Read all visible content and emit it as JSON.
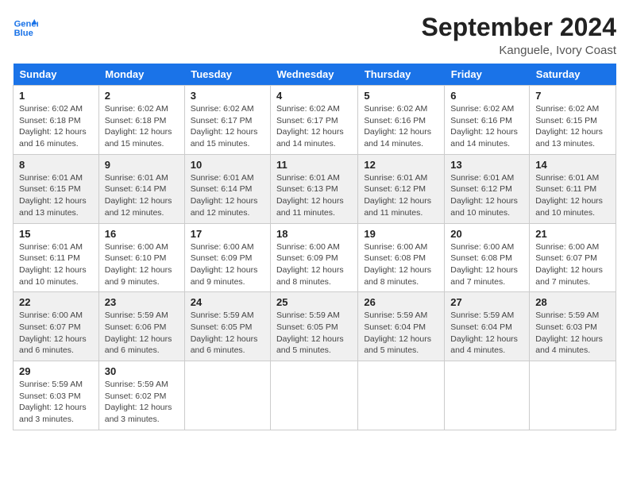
{
  "header": {
    "logo_line1": "General",
    "logo_line2": "Blue",
    "month": "September 2024",
    "location": "Kanguele, Ivory Coast"
  },
  "days_of_week": [
    "Sunday",
    "Monday",
    "Tuesday",
    "Wednesday",
    "Thursday",
    "Friday",
    "Saturday"
  ],
  "weeks": [
    [
      {
        "day": "1",
        "info": "Sunrise: 6:02 AM\nSunset: 6:18 PM\nDaylight: 12 hours\nand 16 minutes."
      },
      {
        "day": "2",
        "info": "Sunrise: 6:02 AM\nSunset: 6:18 PM\nDaylight: 12 hours\nand 15 minutes."
      },
      {
        "day": "3",
        "info": "Sunrise: 6:02 AM\nSunset: 6:17 PM\nDaylight: 12 hours\nand 15 minutes."
      },
      {
        "day": "4",
        "info": "Sunrise: 6:02 AM\nSunset: 6:17 PM\nDaylight: 12 hours\nand 14 minutes."
      },
      {
        "day": "5",
        "info": "Sunrise: 6:02 AM\nSunset: 6:16 PM\nDaylight: 12 hours\nand 14 minutes."
      },
      {
        "day": "6",
        "info": "Sunrise: 6:02 AM\nSunset: 6:16 PM\nDaylight: 12 hours\nand 14 minutes."
      },
      {
        "day": "7",
        "info": "Sunrise: 6:02 AM\nSunset: 6:15 PM\nDaylight: 12 hours\nand 13 minutes."
      }
    ],
    [
      {
        "day": "8",
        "info": "Sunrise: 6:01 AM\nSunset: 6:15 PM\nDaylight: 12 hours\nand 13 minutes."
      },
      {
        "day": "9",
        "info": "Sunrise: 6:01 AM\nSunset: 6:14 PM\nDaylight: 12 hours\nand 12 minutes."
      },
      {
        "day": "10",
        "info": "Sunrise: 6:01 AM\nSunset: 6:14 PM\nDaylight: 12 hours\nand 12 minutes."
      },
      {
        "day": "11",
        "info": "Sunrise: 6:01 AM\nSunset: 6:13 PM\nDaylight: 12 hours\nand 11 minutes."
      },
      {
        "day": "12",
        "info": "Sunrise: 6:01 AM\nSunset: 6:12 PM\nDaylight: 12 hours\nand 11 minutes."
      },
      {
        "day": "13",
        "info": "Sunrise: 6:01 AM\nSunset: 6:12 PM\nDaylight: 12 hours\nand 10 minutes."
      },
      {
        "day": "14",
        "info": "Sunrise: 6:01 AM\nSunset: 6:11 PM\nDaylight: 12 hours\nand 10 minutes."
      }
    ],
    [
      {
        "day": "15",
        "info": "Sunrise: 6:01 AM\nSunset: 6:11 PM\nDaylight: 12 hours\nand 10 minutes."
      },
      {
        "day": "16",
        "info": "Sunrise: 6:00 AM\nSunset: 6:10 PM\nDaylight: 12 hours\nand 9 minutes."
      },
      {
        "day": "17",
        "info": "Sunrise: 6:00 AM\nSunset: 6:09 PM\nDaylight: 12 hours\nand 9 minutes."
      },
      {
        "day": "18",
        "info": "Sunrise: 6:00 AM\nSunset: 6:09 PM\nDaylight: 12 hours\nand 8 minutes."
      },
      {
        "day": "19",
        "info": "Sunrise: 6:00 AM\nSunset: 6:08 PM\nDaylight: 12 hours\nand 8 minutes."
      },
      {
        "day": "20",
        "info": "Sunrise: 6:00 AM\nSunset: 6:08 PM\nDaylight: 12 hours\nand 7 minutes."
      },
      {
        "day": "21",
        "info": "Sunrise: 6:00 AM\nSunset: 6:07 PM\nDaylight: 12 hours\nand 7 minutes."
      }
    ],
    [
      {
        "day": "22",
        "info": "Sunrise: 6:00 AM\nSunset: 6:07 PM\nDaylight: 12 hours\nand 6 minutes."
      },
      {
        "day": "23",
        "info": "Sunrise: 5:59 AM\nSunset: 6:06 PM\nDaylight: 12 hours\nand 6 minutes."
      },
      {
        "day": "24",
        "info": "Sunrise: 5:59 AM\nSunset: 6:05 PM\nDaylight: 12 hours\nand 6 minutes."
      },
      {
        "day": "25",
        "info": "Sunrise: 5:59 AM\nSunset: 6:05 PM\nDaylight: 12 hours\nand 5 minutes."
      },
      {
        "day": "26",
        "info": "Sunrise: 5:59 AM\nSunset: 6:04 PM\nDaylight: 12 hours\nand 5 minutes."
      },
      {
        "day": "27",
        "info": "Sunrise: 5:59 AM\nSunset: 6:04 PM\nDaylight: 12 hours\nand 4 minutes."
      },
      {
        "day": "28",
        "info": "Sunrise: 5:59 AM\nSunset: 6:03 PM\nDaylight: 12 hours\nand 4 minutes."
      }
    ],
    [
      {
        "day": "29",
        "info": "Sunrise: 5:59 AM\nSunset: 6:03 PM\nDaylight: 12 hours\nand 3 minutes."
      },
      {
        "day": "30",
        "info": "Sunrise: 5:59 AM\nSunset: 6:02 PM\nDaylight: 12 hours\nand 3 minutes."
      },
      {
        "day": "",
        "info": ""
      },
      {
        "day": "",
        "info": ""
      },
      {
        "day": "",
        "info": ""
      },
      {
        "day": "",
        "info": ""
      },
      {
        "day": "",
        "info": ""
      }
    ]
  ]
}
